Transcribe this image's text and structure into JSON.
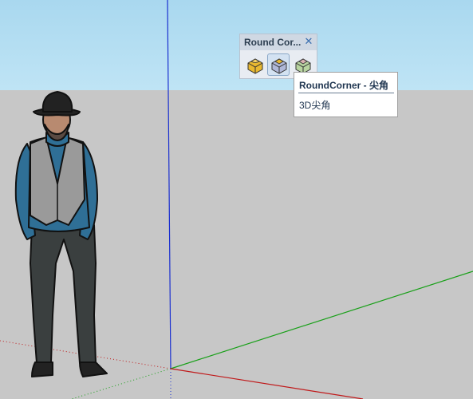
{
  "toolbar": {
    "title": "Round Cor...",
    "close_symbol": "✕",
    "buttons": [
      {
        "icon": "round-corner-icon",
        "state": "normal"
      },
      {
        "icon": "sharp-corner-icon",
        "state": "active"
      },
      {
        "icon": "bevel-corner-icon",
        "state": "normal"
      }
    ]
  },
  "tooltip": {
    "title": "RoundCorner - 尖角",
    "description": "3D尖角"
  },
  "colors": {
    "sky": "#bfe4f5",
    "ground": "#c7c7c7",
    "axis_blue": "#1a2fd0",
    "axis_red": "#c0191a",
    "axis_green": "#18a018"
  }
}
